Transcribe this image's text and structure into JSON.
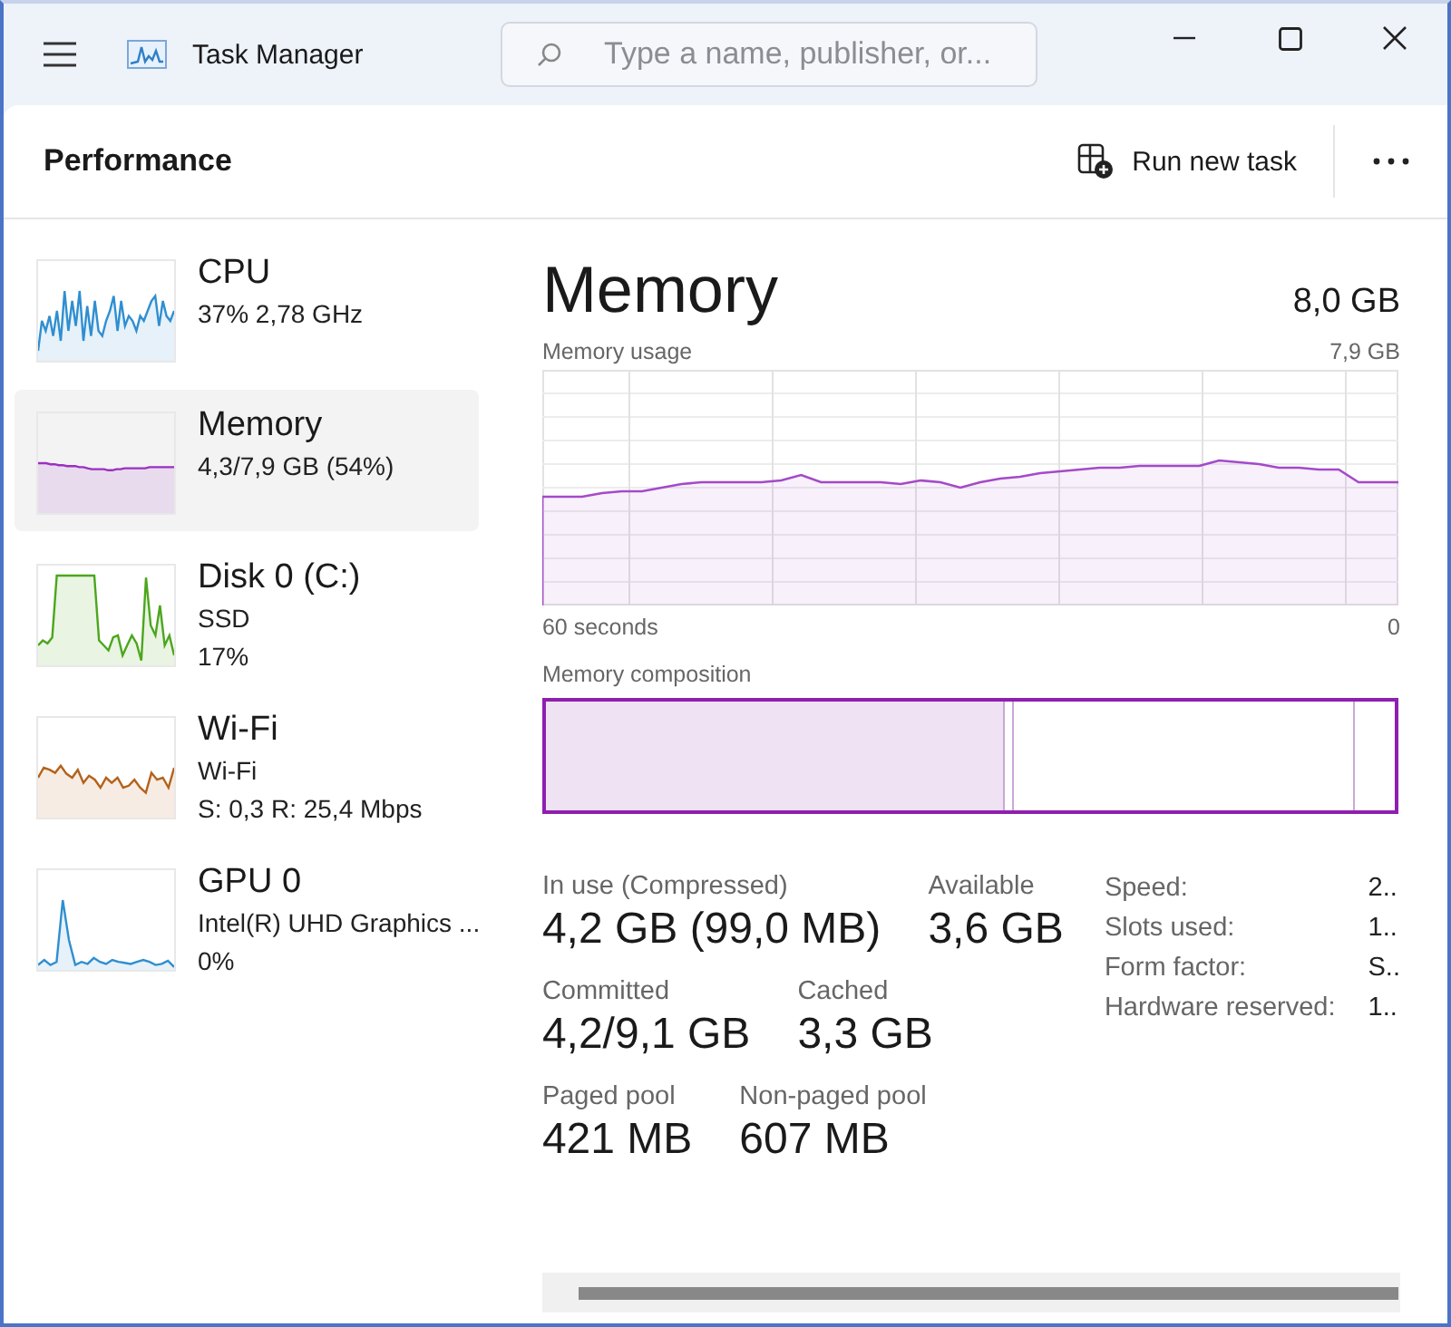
{
  "window": {
    "title": "Task Manager"
  },
  "search": {
    "placeholder": "Type a name, publisher, or..."
  },
  "header": {
    "title": "Performance",
    "run_new_task": "Run new task"
  },
  "sidebar": {
    "items": [
      {
        "kind": "cpu",
        "title": "CPU",
        "lines": [
          "37%  2,78 GHz"
        ],
        "color": "#2f8fd0",
        "selected": false
      },
      {
        "kind": "memory",
        "title": "Memory",
        "lines": [
          "4,3/7,9 GB (54%)"
        ],
        "color": "#9b2fc2",
        "selected": true
      },
      {
        "kind": "disk",
        "title": "Disk 0 (C:)",
        "lines": [
          "SSD",
          "17%"
        ],
        "color": "#4ca61c",
        "selected": false
      },
      {
        "kind": "network",
        "title": "Wi-Fi",
        "lines": [
          "Wi-Fi",
          "S: 0,3  R: 25,4 Mbps"
        ],
        "color": "#b4621a",
        "selected": false
      },
      {
        "kind": "gpu",
        "title": "GPU 0",
        "lines": [
          "Intel(R) UHD Graphics ...",
          "0%"
        ],
        "color": "#2f8fd0",
        "selected": false
      }
    ]
  },
  "detail": {
    "title": "Memory",
    "total": "8,0 GB",
    "usage_label": "Memory usage",
    "usage_max": "7,9 GB",
    "time_start": "60 seconds",
    "time_end": "0",
    "composition_label": "Memory composition",
    "composition": {
      "level": 0.54
    },
    "stats": [
      [
        {
          "label": "In use (Compressed)",
          "value": "4,2 GB (99,0 MB)"
        },
        {
          "label": "Available",
          "value": "3,6 GB"
        }
      ],
      [
        {
          "label": "Committed",
          "value": "4,2/9,1 GB"
        },
        {
          "label": "Cached",
          "value": "3,3 GB"
        }
      ],
      [
        {
          "label": "Paged pool",
          "value": "421 MB"
        },
        {
          "label": "Non-paged pool",
          "value": "607 MB"
        }
      ]
    ],
    "details": [
      {
        "label": "Speed:",
        "value": "2.."
      },
      {
        "label": "Slots used:",
        "value": "1.."
      },
      {
        "label": "Form factor:",
        "value": "S.."
      },
      {
        "label": "Hardware reserved:",
        "value": "1.."
      }
    ]
  }
}
